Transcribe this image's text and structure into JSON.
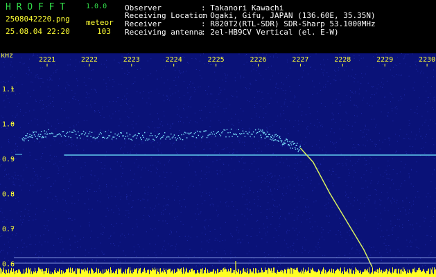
{
  "header": {
    "app_name": "H R O F F T",
    "version": "1.0.0",
    "filename": "2508042220.png",
    "mode": "meteor",
    "datetime": "25.08.04 22:20",
    "count": "103",
    "info_labels": [
      "Observer",
      "Receiving Location",
      "Receiver",
      "Receiving antenna"
    ],
    "info_values": [
      ": Takanori Kawachi",
      ": Ogaki, Gifu, JAPAN (136.60E, 35.35N)",
      ": R820T2(RTL-SDR) SDR-Sharp 53.1000MHz",
      ": 2el-HB9CV Vertical (el. E-W)"
    ]
  },
  "chart_data": {
    "type": "spectrogram",
    "x_unit_note": "time (seconds after 22:20)",
    "y_unit": "kHz",
    "x_ticks": [
      "2221",
      "2222",
      "2223",
      "2224",
      "2225",
      "2226",
      "2227",
      "2228",
      "2229",
      "2230"
    ],
    "y_ticks": [
      "1.1",
      "1.0",
      "0.9",
      "0.8",
      "0.7",
      "0.6"
    ],
    "ylim": [
      0.58,
      1.15
    ],
    "xlim": [
      2220.4,
      2230.1
    ],
    "constant_carrier_khz": 0.91,
    "meteor_head_echo": [
      {
        "x": 2220.4,
        "y": 0.96
      },
      {
        "x": 2221.0,
        "y": 0.975
      },
      {
        "x": 2222.0,
        "y": 0.97
      },
      {
        "x": 2223.0,
        "y": 0.965
      },
      {
        "x": 2224.0,
        "y": 0.965
      },
      {
        "x": 2225.0,
        "y": 0.975
      },
      {
        "x": 2226.0,
        "y": 0.975
      },
      {
        "x": 2226.5,
        "y": 0.955
      },
      {
        "x": 2227.0,
        "y": 0.93
      },
      {
        "x": 2227.3,
        "y": 0.89
      },
      {
        "x": 2227.7,
        "y": 0.8
      },
      {
        "x": 2228.1,
        "y": 0.72
      },
      {
        "x": 2228.5,
        "y": 0.64
      },
      {
        "x": 2228.7,
        "y": 0.59
      }
    ],
    "colors": {
      "background": "#0a1278",
      "noise": "#2b3bd0",
      "carrier": "#6ee6ff",
      "head_echo": "#7fe8ff",
      "meteor_trail": "#d8f060",
      "axis_text": "#ffff33",
      "bottom_band": "#ffff22"
    }
  }
}
